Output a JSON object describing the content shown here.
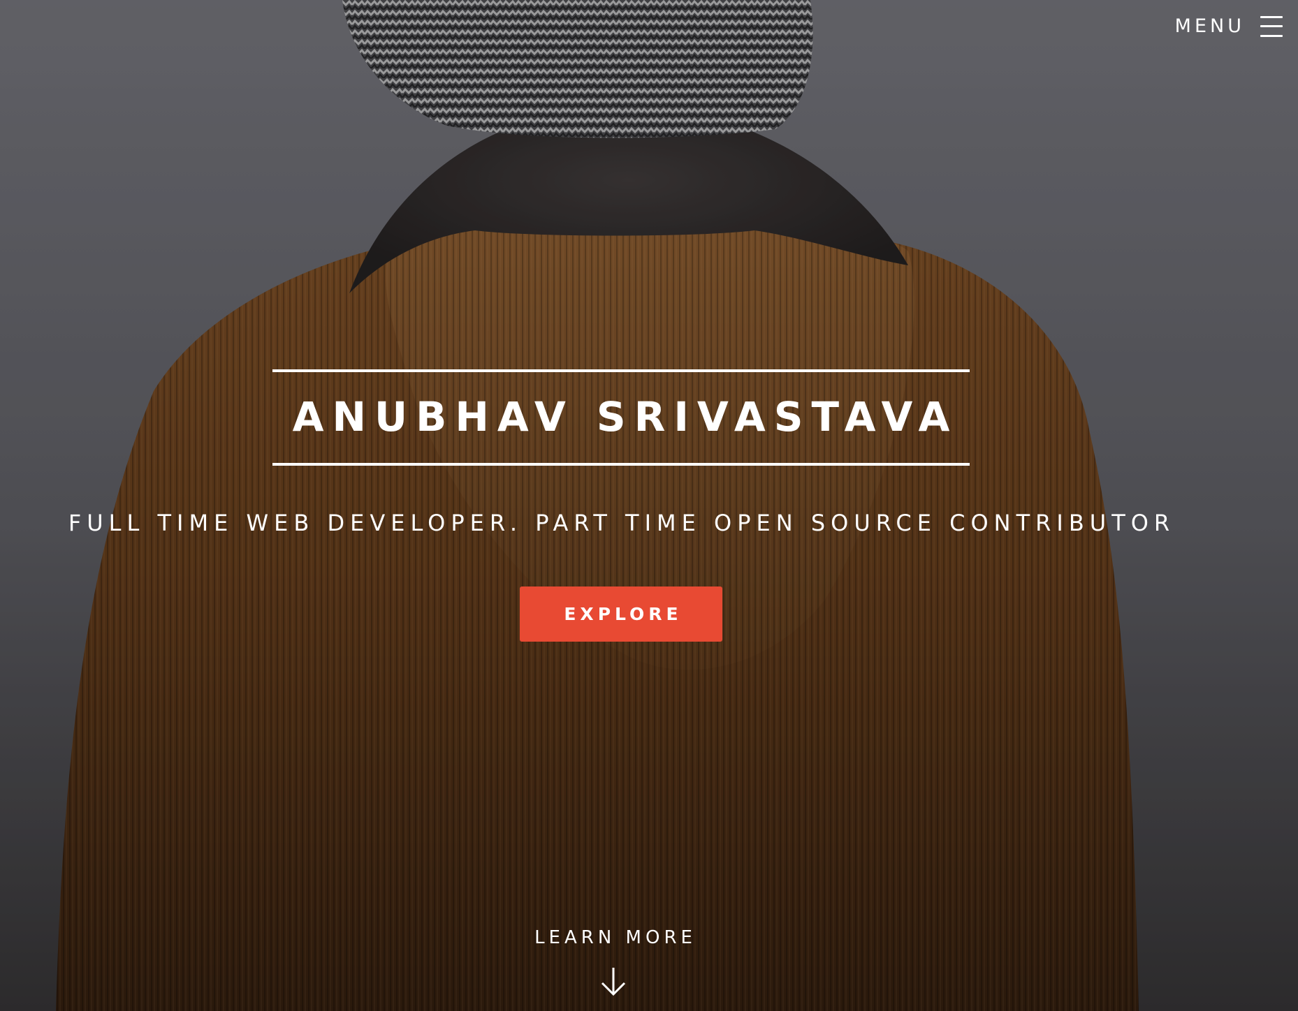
{
  "nav": {
    "menu_label": "MENU",
    "menu_icon": "hamburger-icon"
  },
  "hero": {
    "name": "ANUBHAV SRIVASTAVA",
    "tagline": "FULL TIME WEB DEVELOPER. PART TIME OPEN SOURCE CONTRIBUTOR",
    "explore_label": "EXPLORE",
    "learn_more_label": "LEARN MORE",
    "learn_more_icon": "arrow-down-icon",
    "background_image": "person-in-corduroy-hooded-jacket-and-knit-beanie-from-behind"
  },
  "colors": {
    "accent": "#e84a33",
    "text": "#ffffff",
    "background_sky": "#7a7a82",
    "jacket": "#7a4a22"
  }
}
